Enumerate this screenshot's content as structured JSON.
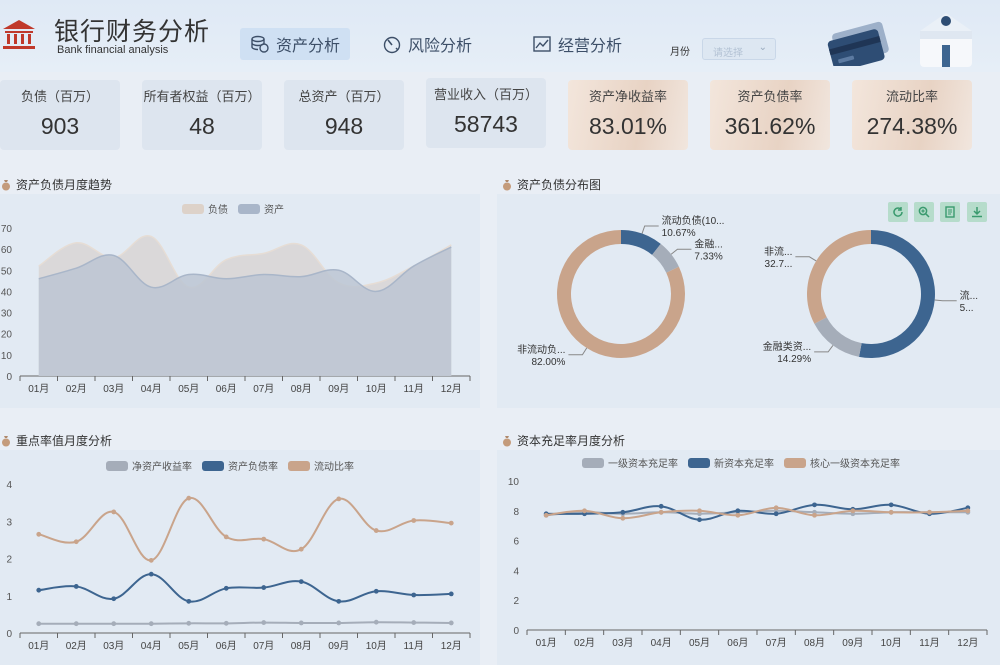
{
  "header": {
    "title": "银行财务分析",
    "subtitle": "Bank financial analysis",
    "tabs": [
      {
        "label": "资产分析",
        "icon": "coins-icon",
        "active": true
      },
      {
        "label": "风险分析",
        "icon": "gauge-icon",
        "active": false
      },
      {
        "label": "经营分析",
        "icon": "trend-chart-icon",
        "active": false
      }
    ],
    "month_label": "月份",
    "month_placeholder": "请选择"
  },
  "kpis": [
    {
      "label": "负债（百万）",
      "value": "903",
      "style": "plain"
    },
    {
      "label": "所有者权益（百万）",
      "value": "48",
      "style": "plain"
    },
    {
      "label": "总资产（百万）",
      "value": "948",
      "style": "plain"
    },
    {
      "label": "营业收入（百万）",
      "value": "58743",
      "style": "plain"
    },
    {
      "label": "资产净收益率",
      "value": "83.01%",
      "style": "warm"
    },
    {
      "label": "资产负债率",
      "value": "361.62%",
      "style": "warm"
    },
    {
      "label": "流动比率",
      "value": "274.38%",
      "style": "warm"
    }
  ],
  "sections": {
    "trend_title": "资产负债月度趋势",
    "dist_title": "资产负债分布图",
    "ratio_title": "重点率值月度分析",
    "capital_title": "资本充足率月度分析"
  },
  "toolbox": [
    "refresh-icon",
    "zoom-icon",
    "data-view-icon",
    "download-icon"
  ],
  "colors": {
    "navy": "#3d6590",
    "tan": "#c9a48b",
    "grey": "#a5adb9",
    "fill_tan": "#d9d6d6",
    "fill_grey": "#bcc5d2"
  },
  "chart_data": [
    {
      "type": "area",
      "title": "资产负债月度趋势",
      "categories": [
        "01月",
        "02月",
        "03月",
        "04月",
        "05月",
        "06月",
        "07月",
        "08月",
        "09月",
        "10月",
        "11月",
        "12月"
      ],
      "ylim": [
        0,
        70
      ],
      "yticks": [
        0,
        10,
        20,
        30,
        40,
        50,
        60,
        70
      ],
      "series": [
        {
          "name": "负债",
          "values": [
            52,
            63,
            56,
            66,
            42,
            55,
            58,
            62,
            44,
            44,
            52,
            62
          ]
        },
        {
          "name": "资产",
          "values": [
            46,
            51,
            57,
            42,
            48,
            46,
            48,
            47,
            50,
            40,
            52,
            61
          ]
        }
      ]
    },
    {
      "type": "pie",
      "title": "资产负债分布图",
      "rings": [
        {
          "slices": [
            {
              "name": "流动负债(10...",
              "label": "流动负债(10...",
              "value": 10.67,
              "pct": "10.67%",
              "color": "#3d6590"
            },
            {
              "name": "金融...",
              "label": "金融...",
              "value": 7.33,
              "pct": "7.33%",
              "color": "#a5adb9"
            },
            {
              "name": "非流动负...",
              "label": "非流动负...",
              "value": 82.0,
              "pct": "82.00%",
              "color": "#c9a48b"
            }
          ]
        },
        {
          "slices": [
            {
              "name": "流...",
              "label": "流...",
              "value": 53.0,
              "pct": "5...",
              "color": "#3d6590"
            },
            {
              "name": "金融类资...",
              "label": "金融类资...",
              "value": 14.29,
              "pct": "14.29%",
              "color": "#a5adb9"
            },
            {
              "name": "非流...",
              "label": "非流...",
              "value": 32.71,
              "pct": "32.7...",
              "color": "#c9a48b"
            }
          ]
        }
      ]
    },
    {
      "type": "line",
      "title": "重点率值月度分析",
      "categories": [
        "01月",
        "02月",
        "03月",
        "04月",
        "05月",
        "06月",
        "07月",
        "08月",
        "09月",
        "10月",
        "11月",
        "12月"
      ],
      "ylim": [
        0,
        4
      ],
      "yticks": [
        0,
        1,
        2,
        3,
        4
      ],
      "series": [
        {
          "name": "净资产收益率",
          "values": [
            0.25,
            0.25,
            0.25,
            0.25,
            0.26,
            0.26,
            0.28,
            0.27,
            0.27,
            0.29,
            0.28,
            0.27
          ]
        },
        {
          "name": "资产负债率",
          "values": [
            1.15,
            1.25,
            0.92,
            1.58,
            0.85,
            1.2,
            1.22,
            1.38,
            0.85,
            1.12,
            1.02,
            1.05
          ]
        },
        {
          "name": "流动比率",
          "values": [
            2.65,
            2.45,
            3.25,
            1.95,
            3.62,
            2.58,
            2.52,
            2.25,
            3.6,
            2.75,
            3.02,
            2.95
          ]
        }
      ]
    },
    {
      "type": "line",
      "title": "资本充足率月度分析",
      "categories": [
        "01月",
        "02月",
        "03月",
        "04月",
        "05月",
        "06月",
        "07月",
        "08月",
        "09月",
        "10月",
        "11月",
        "12月"
      ],
      "ylim": [
        0,
        10
      ],
      "yticks": [
        0,
        2,
        4,
        6,
        8,
        10
      ],
      "series": [
        {
          "name": "一级资本充足率",
          "values": [
            7.7,
            7.9,
            7.8,
            7.9,
            7.8,
            7.9,
            8.0,
            7.9,
            7.8,
            7.9,
            7.9,
            7.9
          ]
        },
        {
          "name": "新资本充足率",
          "values": [
            7.8,
            7.8,
            7.9,
            8.3,
            7.4,
            8.0,
            7.8,
            8.4,
            8.1,
            8.4,
            7.8,
            8.2
          ]
        },
        {
          "name": "核心一级资本充足率",
          "values": [
            7.7,
            8.0,
            7.5,
            7.9,
            8.0,
            7.7,
            8.2,
            7.7,
            8.0,
            7.9,
            7.9,
            8.0
          ]
        }
      ]
    }
  ]
}
